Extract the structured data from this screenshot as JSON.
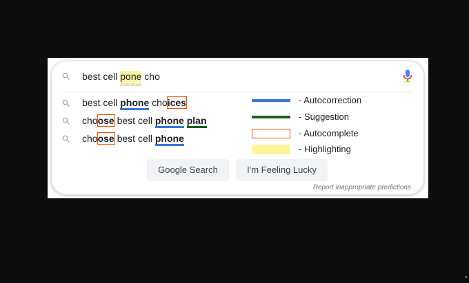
{
  "search": {
    "query_before": "best cell ",
    "query_highlight": "pone",
    "query_after": " cho"
  },
  "suggestions": [
    {
      "parts": [
        {
          "text": "best cell ",
          "style": "plain"
        },
        {
          "text": "phone",
          "style": "corr"
        },
        {
          "text": " cho",
          "style": "plain"
        },
        {
          "text": "ices",
          "style": "ac"
        }
      ]
    },
    {
      "parts": [
        {
          "text": "cho",
          "style": "plain"
        },
        {
          "text": "ose",
          "style": "ac"
        },
        {
          "text": " best cell ",
          "style": "plain"
        },
        {
          "text": "phone",
          "style": "corr"
        },
        {
          "text": " ",
          "style": "plain"
        },
        {
          "text": "plan",
          "style": "sugg"
        }
      ]
    },
    {
      "parts": [
        {
          "text": "cho",
          "style": "plain"
        },
        {
          "text": "ose",
          "style": "ac"
        },
        {
          "text": " best cell ",
          "style": "plain"
        },
        {
          "text": "phone",
          "style": "corr"
        }
      ]
    }
  ],
  "legend": [
    {
      "label": "- Autocorrection",
      "kind": "line",
      "color": "#3a78d4"
    },
    {
      "label": "- Suggestion",
      "kind": "line",
      "color": "#1b5e20"
    },
    {
      "label": "- Autocomplete",
      "kind": "box",
      "color": "#e65100"
    },
    {
      "label": "- Highlighting",
      "kind": "fill",
      "color": "#fff59d"
    }
  ],
  "buttons": {
    "google_search": "Google Search",
    "feeling_lucky": "I'm Feeling Lucky"
  },
  "report_link": "Report inappropriate predictions",
  "corner_glyph": "^"
}
